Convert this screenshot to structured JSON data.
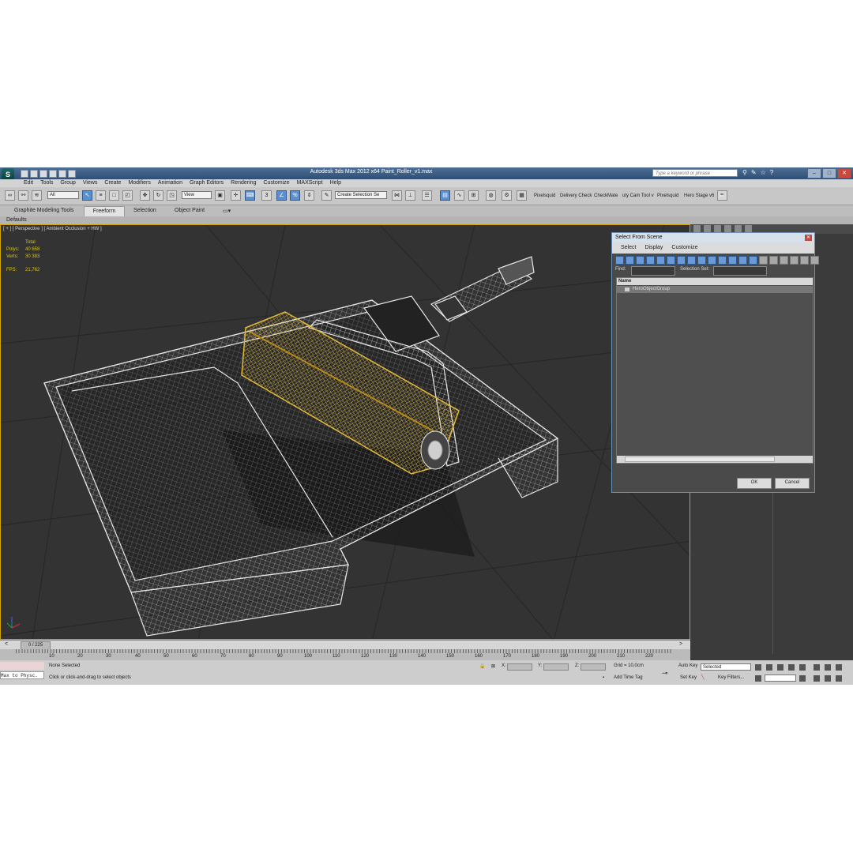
{
  "app": {
    "title": "Autodesk 3ds Max  2012 x64     Paint_Roller_v1.max",
    "logo": "3ds-max-logo",
    "search_placeholder": "Type a keyword or phrase"
  },
  "menu": [
    "Edit",
    "Tools",
    "Group",
    "Views",
    "Create",
    "Modifiers",
    "Animation",
    "Graph Editors",
    "Rendering",
    "Customize",
    "MAXScript",
    "Help"
  ],
  "toolbar": {
    "filter_value": "All",
    "ref_coord_value": "View",
    "selection_set_placeholder": "Create Selection Se",
    "plugins": [
      "Pixelsquid",
      "Delivery Check",
      "CheckMate",
      "uty Cam Tool v",
      "Pixelsquid",
      "Hero Stage v6"
    ]
  },
  "ribbon": {
    "tabs": [
      "Graphite Modeling Tools",
      "Freeform",
      "Selection",
      "Object Paint"
    ],
    "active_tab": "Freeform",
    "sub": "Defaults"
  },
  "viewport": {
    "label": "[ + ] [ Perspective ] [ Ambient Occlusion + HW ]",
    "stats": {
      "total_label": "Total",
      "polys_label": "Polys:",
      "polys_value": "40 658",
      "verts_label": "Verts:",
      "verts_value": "30 383",
      "fps_label": "FPS:",
      "fps_value": "21,762"
    }
  },
  "dialog": {
    "title": "Select From Scene",
    "menu": [
      "Select",
      "Display",
      "Customize"
    ],
    "find_label": "Find:",
    "selection_set_label": "Selection Set:",
    "column_name": "Name",
    "items": [
      "HeroObjectGroup"
    ],
    "ok": "OK",
    "cancel": "Cancel"
  },
  "timeline": {
    "slider": "0 / 225",
    "ticks": [
      "10",
      "20",
      "30",
      "40",
      "50",
      "60",
      "70",
      "80",
      "90",
      "100",
      "110",
      "120",
      "130",
      "140",
      "150",
      "160",
      "170",
      "180",
      "190",
      "200",
      "210",
      "220"
    ]
  },
  "status": {
    "script_listener": "Max to Physc.",
    "selection": "None Selected",
    "prompt": "Click or click-and-drag to select objects",
    "x_label": "X:",
    "y_label": "Y:",
    "z_label": "Z:",
    "grid": "Grid = 10,0cm",
    "add_time_tag": "Add Time Tag",
    "auto_key": "Auto Key",
    "set_key": "Set Key",
    "selected": "Selected",
    "key_filters": "Key Filters..."
  },
  "colors": {
    "viewport_bg": "#333333",
    "active_border": "#d1a300",
    "wire_white": "#e6e6e6",
    "wire_roller": "#e0b83a",
    "stats_text": "#d9c21c"
  }
}
